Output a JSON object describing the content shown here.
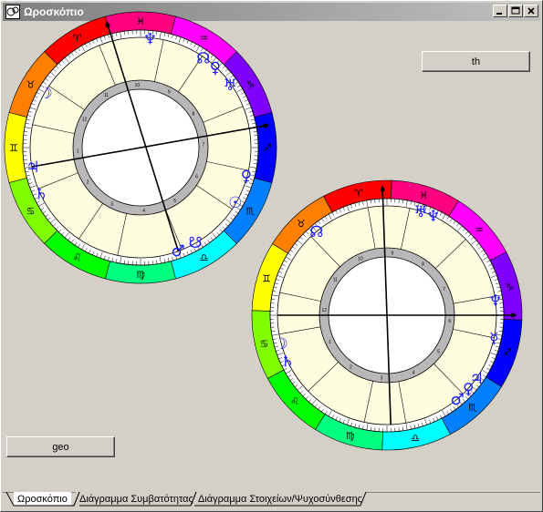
{
  "window": {
    "title": "Ωροσκόπιο"
  },
  "buttons": {
    "th": "th",
    "geo": "geo"
  },
  "tabs": [
    {
      "label": "Ωροσκόπιο",
      "active": true
    },
    {
      "label": "Διάγραμμα Συμβατότητας",
      "active": false
    },
    {
      "label": "Διάγραμμα Στοιχείων/Ψυχοσύνθεσης",
      "active": false
    }
  ],
  "colors": {
    "chart_fill": "#fffde0",
    "glyph_blue": "#1a1aff",
    "inner_ring": "#b8b8b8",
    "zodiac_ring": [
      "#ff0000",
      "#ff7f00",
      "#ffff00",
      "#80ff00",
      "#00ff00",
      "#00ff80",
      "#00ffff",
      "#0080ff",
      "#0000ff",
      "#8000ff",
      "#ff00ff",
      "#ff0080"
    ]
  },
  "charts": [
    {
      "name": "left-wheel",
      "signs": [
        {
          "glyph": "♈",
          "angle": 0,
          "name": "aries"
        },
        {
          "glyph": "♉",
          "angle": 30,
          "name": "taurus"
        },
        {
          "glyph": "♊",
          "angle": 60,
          "name": "gemini"
        },
        {
          "glyph": "♋",
          "angle": 90,
          "name": "cancer"
        },
        {
          "glyph": "♌",
          "angle": 120,
          "name": "leo"
        },
        {
          "glyph": "♍",
          "angle": 150,
          "name": "virgo"
        },
        {
          "glyph": "♎",
          "angle": 180,
          "name": "libra"
        },
        {
          "glyph": "♏",
          "angle": 210,
          "name": "scorpio"
        },
        {
          "glyph": "♐",
          "angle": 240,
          "name": "sagittarius"
        },
        {
          "glyph": "♑",
          "angle": 270,
          "name": "capricorn"
        },
        {
          "glyph": "♒",
          "angle": 300,
          "name": "aquarius"
        },
        {
          "glyph": "♓",
          "angle": 330,
          "name": "pisces"
        }
      ],
      "planets": [
        {
          "glyph": "☊",
          "name": "north-node"
        },
        {
          "glyph": "♀",
          "name": "venus"
        },
        {
          "glyph": "♆",
          "name": "neptune"
        },
        {
          "glyph": "♅",
          "name": "uranus"
        },
        {
          "glyph": "☽",
          "name": "moon"
        },
        {
          "glyph": "♃",
          "name": "jupiter"
        },
        {
          "glyph": "♄",
          "name": "saturn"
        },
        {
          "glyph": "☉",
          "name": "sun"
        },
        {
          "glyph": "♀",
          "name": "venus-2"
        },
        {
          "glyph": "☋",
          "name": "south-node"
        },
        {
          "glyph": "♂",
          "name": "mars"
        }
      ]
    },
    {
      "name": "right-wheel",
      "planets": [
        {
          "glyph": "♆",
          "name": "neptune"
        },
        {
          "glyph": "♅",
          "name": "uranus"
        },
        {
          "glyph": "♆",
          "name": "neptune-2"
        },
        {
          "glyph": "♄",
          "name": "saturn"
        },
        {
          "glyph": "☽",
          "name": "moon"
        },
        {
          "glyph": "♃",
          "name": "jupiter"
        },
        {
          "glyph": "♀",
          "name": "venus"
        },
        {
          "glyph": "♂",
          "name": "mars"
        },
        {
          "glyph": "☿",
          "name": "mercury"
        },
        {
          "glyph": "☊",
          "name": "north-node"
        }
      ]
    }
  ]
}
